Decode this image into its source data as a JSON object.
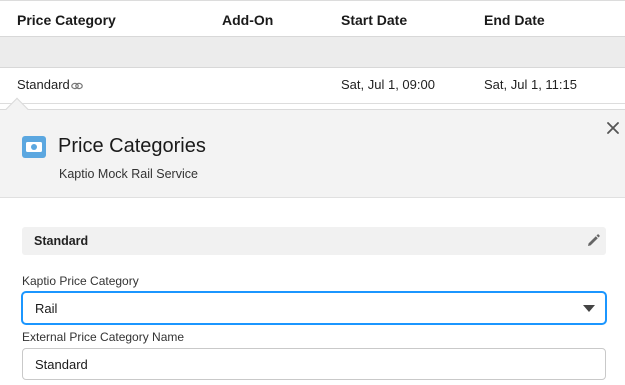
{
  "table": {
    "headers": [
      "Price Category",
      "Add-On",
      "Start Date",
      "End Date"
    ],
    "row": {
      "price_category": "Standard",
      "add_on": "",
      "start_date": "Sat, Jul 1, 09:00",
      "end_date": "Sat, Jul 1, 11:15"
    }
  },
  "panel": {
    "title": "Price Categories",
    "subtitle": "Kaptio Mock Rail Service",
    "icon": "money-icon",
    "section_label": "Standard",
    "fields": {
      "kaptio_price_category": {
        "label": "Kaptio Price Category",
        "value": "Rail"
      },
      "external_name": {
        "label": "External Price Category Name",
        "value": "Standard"
      }
    }
  },
  "colors": {
    "accent": "#1b96ff",
    "icon_bg": "#5ba7e0",
    "header_bg": "#f3f3f3"
  }
}
